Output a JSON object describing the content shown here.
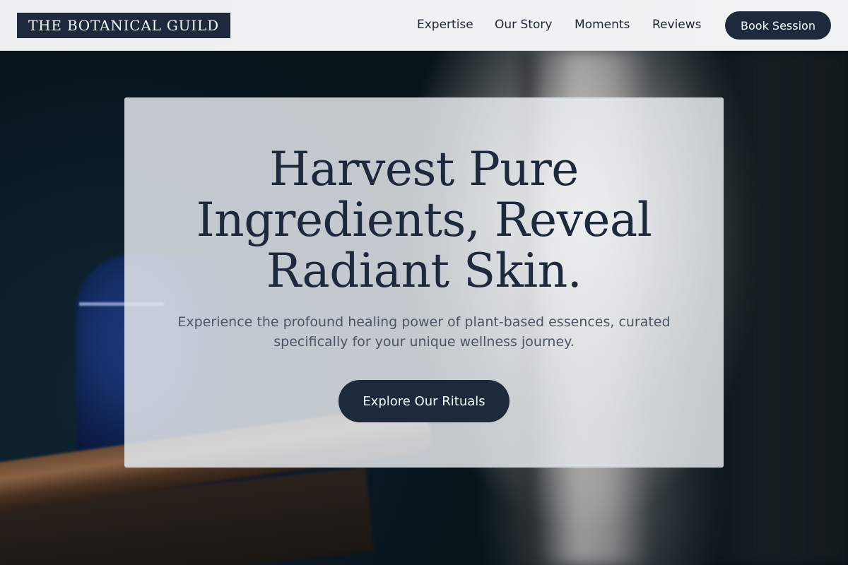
{
  "brand": {
    "name": "THE BOTANICAL GUILD"
  },
  "nav": {
    "items": [
      {
        "label": "Expertise"
      },
      {
        "label": "Our Story"
      },
      {
        "label": "Moments"
      },
      {
        "label": "Reviews"
      }
    ],
    "cta_label": "Book Session"
  },
  "hero": {
    "title": "Harvest Pure Ingredients, Reveal Radiant Skin.",
    "subtitle": "Experience the profound healing power of plant-based essences, curated specifically for your unique wellness journey.",
    "cta_label": "Explore Our Rituals"
  },
  "colors": {
    "primary": "#1e293b",
    "header_bg": "#f1f2f3",
    "text_dark": "#1f2937",
    "text_muted": "#4b5563",
    "card_bg": "#e2e7eb"
  }
}
